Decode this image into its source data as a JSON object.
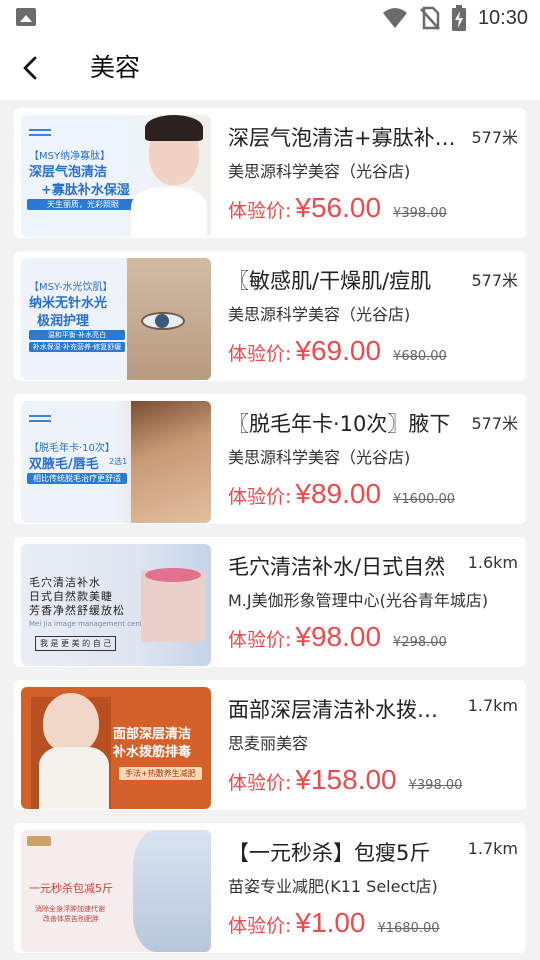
{
  "status_bar": {
    "time": "10:30",
    "icons": [
      "gallery-icon",
      "wifi-icon",
      "no-sim-icon",
      "battery-charging-icon"
    ]
  },
  "nav": {
    "title": "美容",
    "back_icon": "back-arrow-icon"
  },
  "price_label": "体验价:",
  "colors": {
    "price": "#f0494b",
    "background": "#f2f2f2",
    "card": "#ffffff"
  },
  "items": [
    {
      "title": "深层气泡清洁+寡肽补水保湿",
      "distance": "577米",
      "store": "美思源科学美容（光谷店)",
      "price": "¥56.00",
      "original_price": "¥398.00",
      "thumb": {
        "tag": "【MSY纳净寡肽】",
        "line1": "深层气泡清洁",
        "line2": "+寡肽补水保湿",
        "pill": "天生丽质，光彩照眼"
      }
    },
    {
      "title": "〖敏感肌/干燥肌/痘肌",
      "distance": "577米",
      "store": "美思源科学美容（光谷店)",
      "price": "¥69.00",
      "original_price": "¥680.00",
      "thumb": {
        "tag": "【MSY-水光饮肌】",
        "line1": "纳米无针水光",
        "line2": "极润护理",
        "pill": "温和平衡·补水亮白",
        "pill2": "补水保湿·补充营养·修复舒缓"
      }
    },
    {
      "title": "〖脱毛年卡·10次〗腋下",
      "distance": "577米",
      "store": "美思源科学美容（光谷店)",
      "price": "¥89.00",
      "original_price": "¥1600.00",
      "thumb": {
        "tag": "【脱毛年卡·10次】",
        "line1": "双腋毛/唇毛",
        "badge": "2选1",
        "pill": "相比传统脱毛治疗更舒适"
      }
    },
    {
      "title": "毛穴清洁补水/日式自然",
      "distance": "1.6km",
      "store": "M.J美伽形象管理中心(光谷青年城店)",
      "price": "¥98.00",
      "original_price": "¥298.00",
      "thumb": {
        "line1": "毛穴清洁补水",
        "line2": "日式自然款美睫",
        "line3": "芳香净然舒缓放松",
        "sub": "Mei Jia image management center",
        "footer": "我 是 更 美 的 自 己"
      }
    },
    {
      "title": "面部深层清洁补水拨筋排毒",
      "distance": "1.7km",
      "store": "思麦丽美容",
      "price": "¥158.00",
      "original_price": "¥398.00",
      "thumb": {
        "line1": "面部深层清洁",
        "line2": "补水拨筋排毒",
        "pill": "手法+热敷养生减肥"
      }
    },
    {
      "title": "【一元秒杀】包瘦5斤",
      "distance": "1.7km",
      "store": "苗姿专业减肥(K11 Select店)",
      "price": "¥1.00",
      "original_price": "¥1680.00",
      "thumb": {
        "line1": "一元秒杀包减5斤",
        "sub1": "消除全身浮肿加速代谢",
        "sub2": "改善体质告别肥胖"
      }
    }
  ]
}
